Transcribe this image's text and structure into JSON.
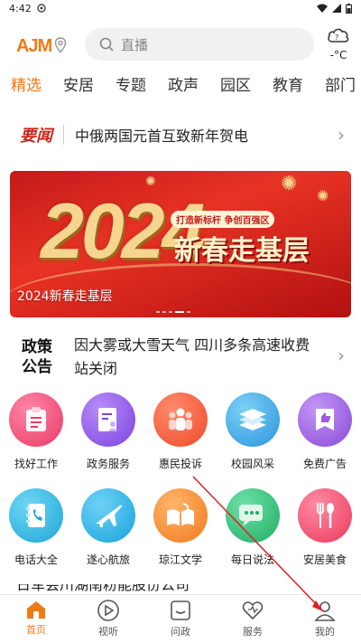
{
  "status": {
    "time": "4:42"
  },
  "header": {
    "logo": "AJM",
    "search_placeholder": "直播",
    "temperature": "-°C"
  },
  "tabs": [
    "精选",
    "安居",
    "专题",
    "政声",
    "园区",
    "教育",
    "部门"
  ],
  "headline": {
    "badge": "要闻",
    "text": "中俄两国元首互致新年贺电"
  },
  "banner": {
    "year": "2024",
    "pill": "打造新标杆 争创百强区",
    "slogan": "新春走基层",
    "caption": "2024新春走基层"
  },
  "policy": {
    "badge_line1": "政策",
    "badge_line2": "公告",
    "text": "因大雾或大雪天气 四川多条高速收费站关闭"
  },
  "services": [
    {
      "label": "找好工作",
      "icon": "clipboard-icon",
      "color": "#f0507a"
    },
    {
      "label": "政务服务",
      "icon": "document-person-icon",
      "color": "#8e58e8"
    },
    {
      "label": "惠民投诉",
      "icon": "people-icon",
      "color": "#f25a3c"
    },
    {
      "label": "校园风采",
      "icon": "books-icon",
      "color": "#3aa7e6"
    },
    {
      "label": "免费广告",
      "icon": "thumbs-up-icon",
      "color": "#9b5ce0"
    },
    {
      "label": "电话大全",
      "icon": "phone-book-icon",
      "color": "#2eb3e0"
    },
    {
      "label": "遂心航旅",
      "icon": "airplane-icon",
      "color": "#27b2e6"
    },
    {
      "label": "琼江文学",
      "icon": "open-book-icon",
      "color": "#f2892b"
    },
    {
      "label": "每日说法",
      "icon": "chat-bubble-icon",
      "color": "#2fc07a"
    },
    {
      "label": "安居美食",
      "icon": "fork-spoon-icon",
      "color": "#f0506a"
    }
  ],
  "peek_text": "日军会川湖南粉能股份公司",
  "bottom_nav": [
    {
      "label": "首页",
      "icon": "home-icon"
    },
    {
      "label": "视听",
      "icon": "play-icon"
    },
    {
      "label": "问政",
      "icon": "message-box-icon"
    },
    {
      "label": "服务",
      "icon": "heart-icon"
    },
    {
      "label": "我的",
      "icon": "person-icon"
    }
  ],
  "colors": {
    "accent": "#f07a14",
    "headline_red": "#d0241c"
  }
}
